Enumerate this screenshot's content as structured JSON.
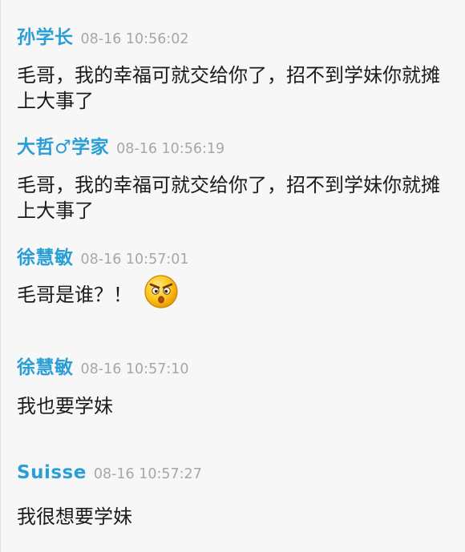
{
  "messages": [
    {
      "sender": "孙学长",
      "time": "08-16 10:56:02",
      "text": "毛哥，我的幸福可就交给你了，招不到学妹你就摊上大事了"
    },
    {
      "sender": "大哲♂学家",
      "time": "08-16 10:56:19",
      "text": "毛哥，我的幸福可就交给你了，招不到学妹你就摊上大事了"
    },
    {
      "sender": "徐慧敏",
      "time": "08-16 10:57:01",
      "text": "毛哥是谁？！",
      "emoji": "angry-surprised-face-icon"
    },
    {
      "sender": "徐慧敏",
      "time": "08-16 10:57:10",
      "text": "我也要学妹"
    },
    {
      "sender": "Suisse",
      "time": "08-16 10:57:27",
      "text": "我很想要学妹"
    }
  ],
  "colors": {
    "name": "#2a9fd6",
    "time": "#a7a7a7",
    "text": "#1b1b1b",
    "background": "#f7f7f7"
  }
}
